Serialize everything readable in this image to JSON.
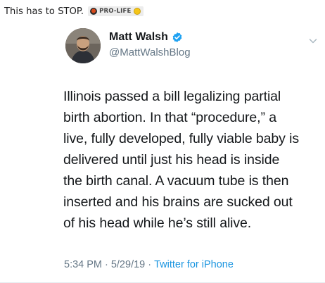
{
  "post": {
    "title": "This has to STOP.",
    "flair": "PRO-LIFE",
    "flair_left_icon": "pro-life-badge-icon",
    "flair_right_icon": "smiley-face-icon"
  },
  "tweet": {
    "author_name": "Matt Walsh",
    "author_handle": "@MattWalshBlog",
    "verified_icon": "verified-badge-icon",
    "menu_icon": "chevron-down-icon",
    "text_lines": [
      "Illinois passed a bill legalizing partial",
      "birth abortion. In that “procedure,” a",
      "live, fully developed, fully viable baby is",
      "delivered until just his head is inside",
      "the birth canal. A vacuum tube is then",
      "inserted and his brains are sucked out",
      "of his head while he’s still alive."
    ],
    "time": "5:34 PM",
    "date": "5/29/19",
    "separator": "·",
    "source": "Twitter for iPhone"
  },
  "colors": {
    "text": "#14171a",
    "secondary": "#657786",
    "link": "#1b95e0",
    "verified": "#1da1f2"
  }
}
